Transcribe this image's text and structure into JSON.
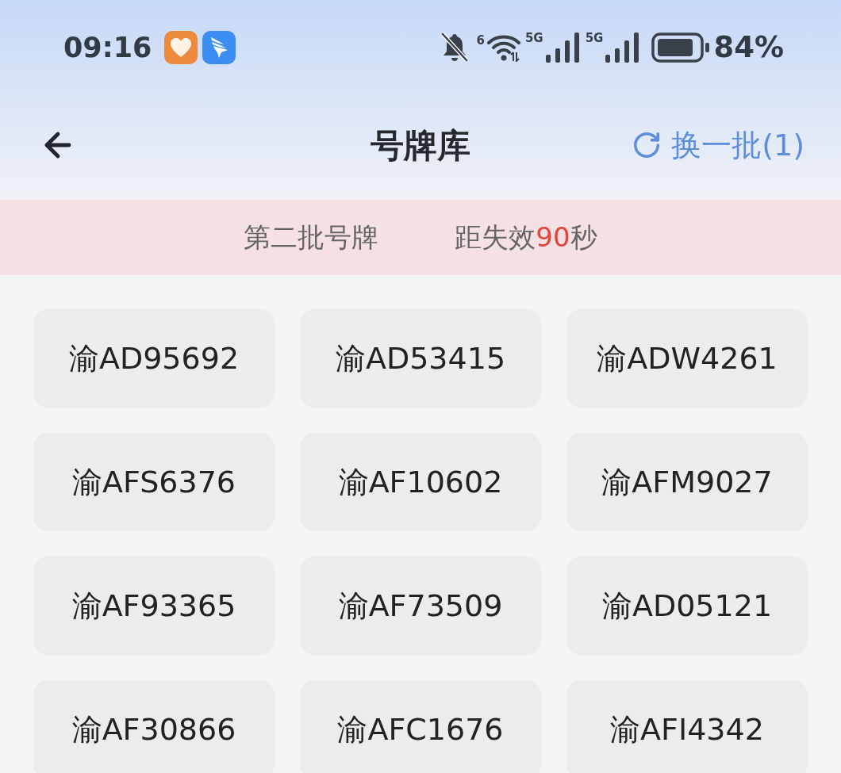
{
  "status_bar": {
    "time": "09:16",
    "wifi_badge": "6",
    "signal_badges": [
      "5G",
      "5G"
    ],
    "battery_text": "84%"
  },
  "nav": {
    "title": "号牌库",
    "refresh_label": "换一批(1)"
  },
  "banner": {
    "batch": "第二批号牌",
    "countdown": {
      "prefix": "距失效",
      "value": "90",
      "suffix": "秒"
    }
  },
  "plates": [
    "渝AD95692",
    "渝AD53415",
    "渝ADW4261",
    "渝AFS6376",
    "渝AF10602",
    "渝AFM9027",
    "渝AF93365",
    "渝AF73509",
    "渝AD05121",
    "渝AF30866",
    "渝AFC1676",
    "渝AFI4342"
  ]
}
